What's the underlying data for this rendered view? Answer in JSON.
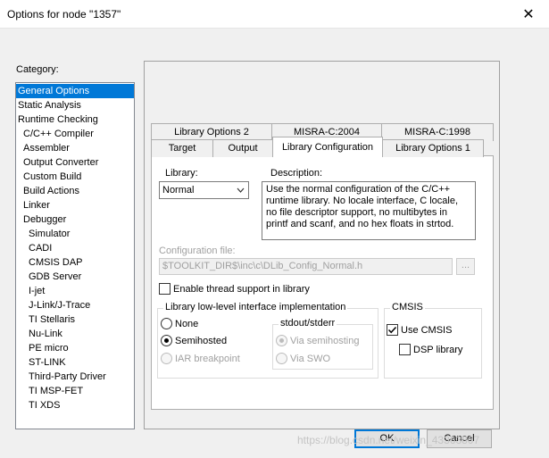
{
  "window": {
    "title": "Options for node \"1357\"",
    "close_icon": "close-icon"
  },
  "category": {
    "label": "Category:",
    "items": [
      "General Options",
      "Static Analysis",
      "Runtime Checking",
      "C/C++ Compiler",
      "Assembler",
      "Output Converter",
      "Custom Build",
      "Build Actions",
      "Linker",
      "Debugger",
      "Simulator",
      "CADI",
      "CMSIS DAP",
      "GDB Server",
      "I-jet",
      "J-Link/J-Trace",
      "TI Stellaris",
      "Nu-Link",
      "PE micro",
      "ST-LINK",
      "Third-Party Driver",
      "TI MSP-FET",
      "TI XDS"
    ],
    "selected": "General Options"
  },
  "tabs": {
    "back_row": [
      "Library Options 2",
      "MISRA-C:2004",
      "MISRA-C:1998"
    ],
    "front_row": [
      "Target",
      "Output",
      "Library Configuration",
      "Library Options 1"
    ],
    "active": "Library Configuration"
  },
  "library": {
    "label": "Library:",
    "value": "Normal",
    "description_label": "Description:",
    "description": "Use the normal configuration of the C/C++ runtime library. No locale interface, C locale, no file descriptor support, no multibytes in printf and scanf, and no hex floats in strtod."
  },
  "config_file": {
    "label": "Configuration file:",
    "value": "$TOOLKIT_DIR$\\inc\\c\\DLib_Config_Normal.h",
    "browse_label": "..."
  },
  "thread_support": {
    "label": "Enable thread support in library",
    "checked": false
  },
  "low_level": {
    "title": "Library low-level interface implementation",
    "options": [
      "None",
      "Semihosted",
      "IAR breakpoint"
    ],
    "selected": "Semihosted",
    "stdout_title": "stdout/stderr",
    "stdout_options": [
      "Via semihosting",
      "Via SWO"
    ],
    "stdout_selected": "Via semihosting"
  },
  "cmsis": {
    "title": "CMSIS",
    "use_cmsis": {
      "label": "Use CMSIS",
      "checked": true
    },
    "dsp_library": {
      "label": "DSP library",
      "checked": false
    }
  },
  "buttons": {
    "ok": "OK",
    "cancel": "Cancel"
  },
  "watermark": "https://blog.csdn.net/weixin_43363807"
}
